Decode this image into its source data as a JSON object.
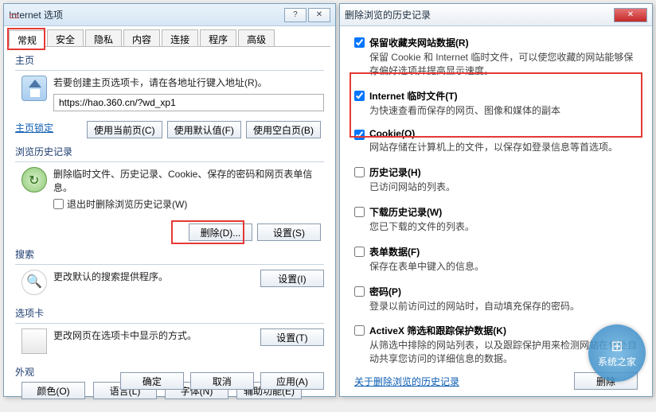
{
  "left": {
    "title": "Internet 选项",
    "tabs": [
      "常规",
      "安全",
      "隐私",
      "内容",
      "连接",
      "程序",
      "高级"
    ],
    "active_tab": 0,
    "home": {
      "title": "主页",
      "hint": "若要创建主页选项卡，请在各地址行键入地址(R)。",
      "url": "https://hao.360.cn/?wd_xp1",
      "lock_label": "主页锁定",
      "btn_current": "使用当前页(C)",
      "btn_default": "使用默认值(F)",
      "btn_blank": "使用空白页(B)"
    },
    "history": {
      "title": "浏览历史记录",
      "hint": "删除临时文件、历史记录、Cookie、保存的密码和网页表单信息。",
      "exit_delete": "退出时删除浏览历史记录(W)",
      "btn_delete": "删除(D)...",
      "btn_settings": "设置(S)"
    },
    "search": {
      "title": "搜索",
      "hint": "更改默认的搜索提供程序。",
      "btn_settings": "设置(I)"
    },
    "tabs_group": {
      "title": "选项卡",
      "hint": "更改网页在选项卡中显示的方式。",
      "btn_settings": "设置(T)"
    },
    "appearance": {
      "title": "外观",
      "btn_color": "颜色(O)",
      "btn_lang": "语言(L)",
      "btn_font": "字体(N)",
      "btn_a11y": "辅助功能(E)"
    },
    "buttons": {
      "ok": "确定",
      "cancel": "取消",
      "apply": "应用(A)"
    }
  },
  "right": {
    "title": "删除浏览的历史记录",
    "opts": [
      {
        "checked": true,
        "t": "保留收藏夹网站数据(R)",
        "d": "保留 Cookie 和 Internet 临时文件，可以使您收藏的网站能够保存偏好选项并提高显示速度。"
      },
      {
        "checked": true,
        "t": "Internet 临时文件(T)",
        "d": "为快速查看而保存的网页、图像和媒体的副本"
      },
      {
        "checked": true,
        "t": "Cookie(O)",
        "d": "网站存储在计算机上的文件，以保存如登录信息等首选项。"
      },
      {
        "checked": false,
        "t": "历史记录(H)",
        "d": "已访问网站的列表。"
      },
      {
        "checked": false,
        "t": "下载历史记录(W)",
        "d": "您已下载的文件的列表。"
      },
      {
        "checked": false,
        "t": "表单数据(F)",
        "d": "保存在表单中键入的信息。"
      },
      {
        "checked": false,
        "t": "密码(P)",
        "d": "登录以前访问过的网站时，自动填充保存的密码。"
      },
      {
        "checked": false,
        "t": "ActiveX 筛选和跟踪保护数据(K)",
        "d": "从筛选中排除的网站列表，以及跟踪保护用来检测网站在何处自动共享您访问的详细信息的数据。"
      }
    ],
    "about": "关于删除浏览的历史记录",
    "btn_delete": "删除",
    "watermark": "系统之家"
  }
}
